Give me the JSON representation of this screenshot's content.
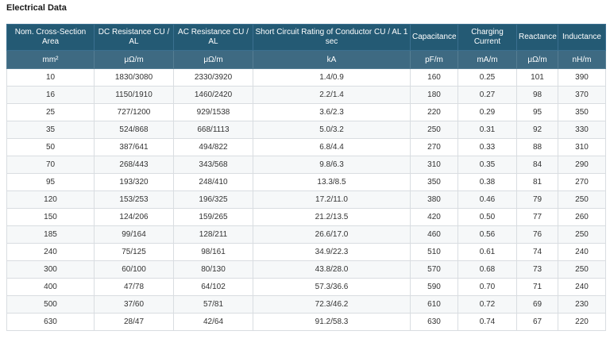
{
  "title": "Electrical Data",
  "table": {
    "headers": [
      "Nom. Cross-Section Area",
      "DC Resistance CU / AL",
      "AC Resistance CU / AL",
      "Short Circuit Rating of Conductor CU / AL 1 sec",
      "Capacitance",
      "Charging Current",
      "Reactance",
      "Inductance"
    ],
    "units": [
      "mm²",
      "μΩ/m",
      "μΩ/m",
      "kA",
      "pF/m",
      "mA/m",
      "μΩ/m",
      "nH/m"
    ],
    "rows": [
      [
        "10",
        "1830/3080",
        "2330/3920",
        "1.4/0.9",
        "160",
        "0.25",
        "101",
        "390"
      ],
      [
        "16",
        "1150/1910",
        "1460/2420",
        "2.2/1.4",
        "180",
        "0.27",
        "98",
        "370"
      ],
      [
        "25",
        "727/1200",
        "929/1538",
        "3.6/2.3",
        "220",
        "0.29",
        "95",
        "350"
      ],
      [
        "35",
        "524/868",
        "668/1113",
        "5.0/3.2",
        "250",
        "0.31",
        "92",
        "330"
      ],
      [
        "50",
        "387/641",
        "494/822",
        "6.8/4.4",
        "270",
        "0.33",
        "88",
        "310"
      ],
      [
        "70",
        "268/443",
        "343/568",
        "9.8/6.3",
        "310",
        "0.35",
        "84",
        "290"
      ],
      [
        "95",
        "193/320",
        "248/410",
        "13.3/8.5",
        "350",
        "0.38",
        "81",
        "270"
      ],
      [
        "120",
        "153/253",
        "196/325",
        "17.2/11.0",
        "380",
        "0.46",
        "79",
        "250"
      ],
      [
        "150",
        "124/206",
        "159/265",
        "21.2/13.5",
        "420",
        "0.50",
        "77",
        "260"
      ],
      [
        "185",
        "99/164",
        "128/211",
        "26.6/17.0",
        "460",
        "0.56",
        "76",
        "250"
      ],
      [
        "240",
        "75/125",
        "98/161",
        "34.9/22.3",
        "510",
        "0.61",
        "74",
        "240"
      ],
      [
        "300",
        "60/100",
        "80/130",
        "43.8/28.0",
        "570",
        "0.68",
        "73",
        "250"
      ],
      [
        "400",
        "47/78",
        "64/102",
        "57.3/36.6",
        "590",
        "0.70",
        "71",
        "240"
      ],
      [
        "500",
        "37/60",
        "57/81",
        "72.3/46.2",
        "610",
        "0.72",
        "69",
        "230"
      ],
      [
        "630",
        "28/47",
        "42/64",
        "91.2/58.3",
        "630",
        "0.74",
        "67",
        "220"
      ]
    ]
  }
}
